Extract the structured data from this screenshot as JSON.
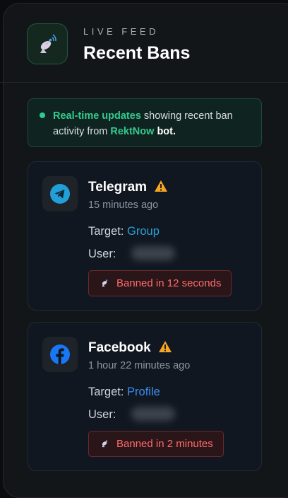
{
  "header": {
    "eyebrow": "LIVE FEED",
    "title": "Recent Bans",
    "icon": "satellite-dish-icon"
  },
  "notice": {
    "part1": "Real-time updates",
    "part2": " showing recent ban activity from ",
    "part3": "RektNow",
    "part4": " bot."
  },
  "bans": [
    {
      "platform": "Telegram",
      "icon": "telegram-icon",
      "time": "15 minutes ago",
      "target_label": "Target:",
      "target_value": "Group",
      "target_color": "#2a9fd6",
      "user_label": "User:",
      "banned_text": "Banned in 12 seconds"
    },
    {
      "platform": "Facebook",
      "icon": "facebook-icon",
      "time": "1 hour 22 minutes ago",
      "target_label": "Target:",
      "target_value": "Profile",
      "target_color": "#3b8ef0",
      "user_label": "User:",
      "banned_text": "Banned in 2 minutes"
    }
  ],
  "colors": {
    "accent_green": "#34c98e",
    "warning": "#f5a623",
    "danger": "#ff6b6b"
  }
}
